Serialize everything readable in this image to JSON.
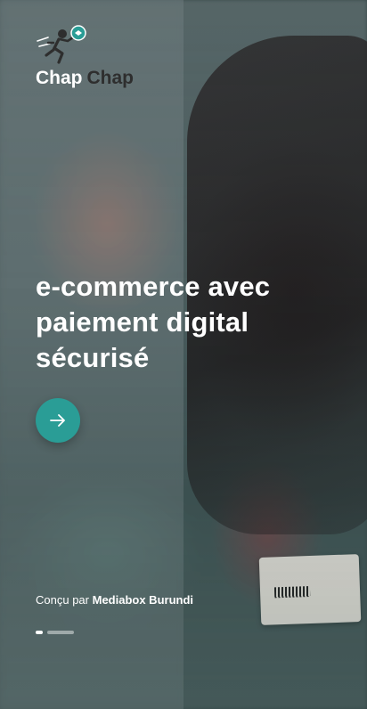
{
  "app": {
    "logo_word1": "Chap",
    "logo_word2": "Chap"
  },
  "hero": {
    "headline_line1": "e-commerce avec",
    "headline_line2": "paiement digital",
    "headline_line3": "sécurisé"
  },
  "next_button": {
    "icon": "arrow-right-icon"
  },
  "footer": {
    "credit_prefix": "Conçu par",
    "credit_brand": "Mediabox Burundi"
  },
  "pagination": {
    "total": 2,
    "current": 1
  },
  "colors": {
    "accent": "#2a9d96",
    "text": "#ffffff",
    "logo_dark": "#2e2e2e"
  }
}
